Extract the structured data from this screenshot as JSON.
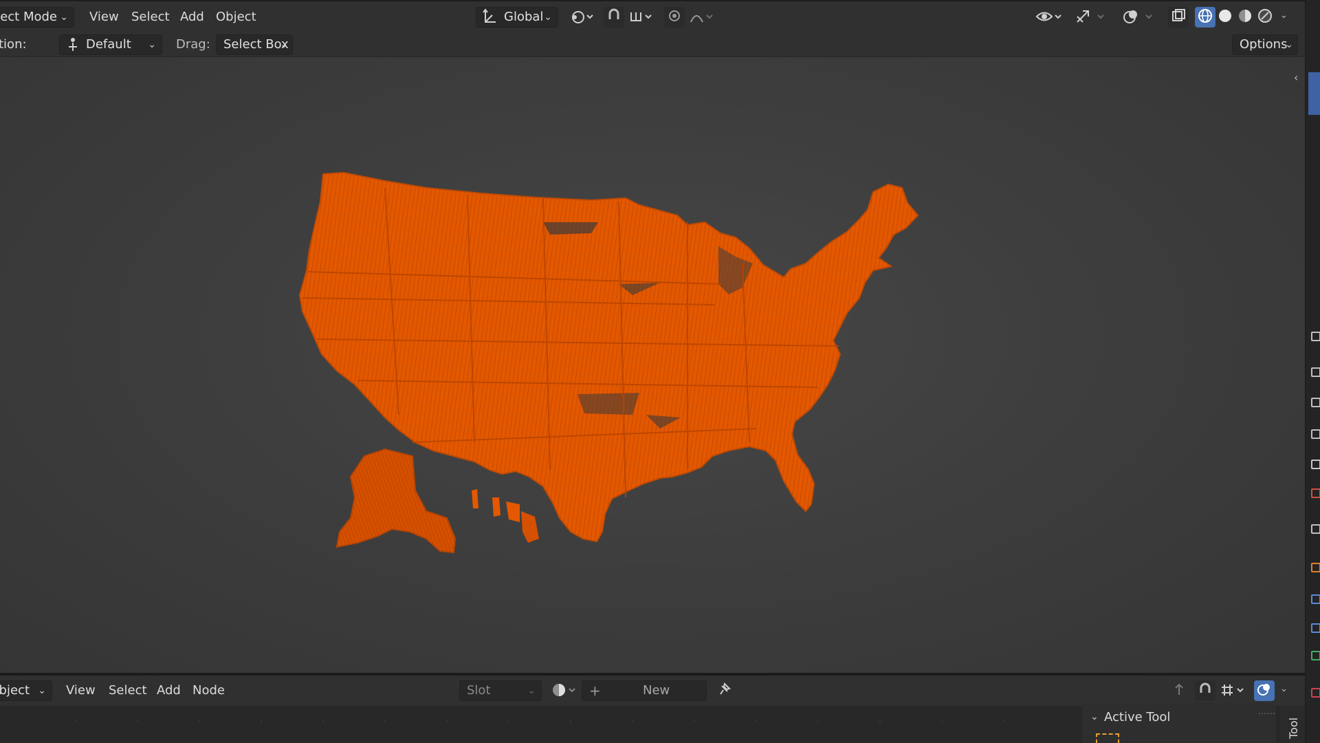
{
  "header": {
    "mode_label": "Object Mode",
    "menu": [
      "View",
      "Select",
      "Add",
      "Object"
    ],
    "transform_orientation": "Global",
    "options_label": "Options"
  },
  "toolbar": {
    "orientation_label_partial": "tion:",
    "orientation_value": "Default",
    "drag_label": "Drag:",
    "drag_value": "Select Box"
  },
  "viewport": {
    "object_color": "#e65a00",
    "object_shadow_color": "#b84400",
    "background": "#3d3d3d"
  },
  "node_editor": {
    "type_label": "Object",
    "menu": [
      "View",
      "Select",
      "Add",
      "Node"
    ],
    "slot_label": "Slot",
    "new_label": "New"
  },
  "side_panel": {
    "active_tool_label": "Active Tool",
    "tab_label": "Tool"
  },
  "icons": {
    "transform": "axes-icon",
    "pivot": "pivot-icon",
    "snap": "magnet-icon",
    "proportional": "proportional-editing-icon",
    "visibility": "eye-icon",
    "gizmo": "gizmo-icon",
    "overlay": "overlay-icon",
    "xray": "xray-icon",
    "shading": [
      "wireframe-icon",
      "solid-icon",
      "material-icon",
      "rendered-icon"
    ],
    "pin": "pin-icon"
  }
}
